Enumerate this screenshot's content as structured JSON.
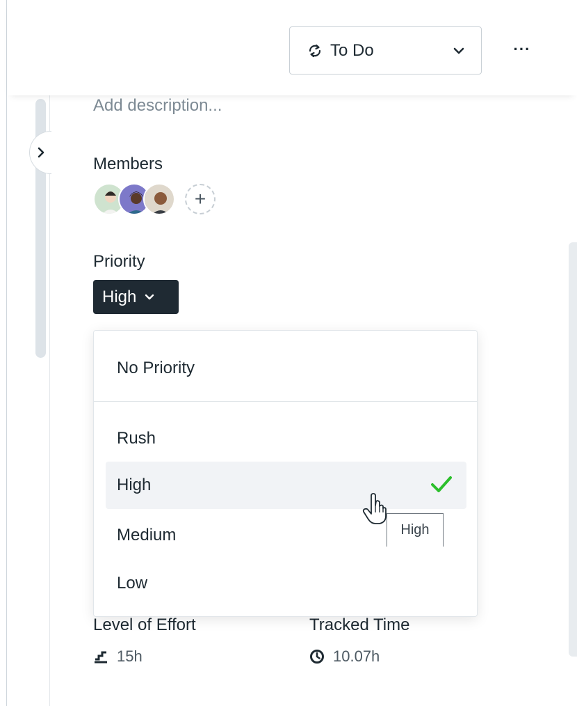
{
  "header": {
    "status": {
      "label": "To Do",
      "icon": "status-cycle-icon"
    },
    "more_label": "···"
  },
  "task": {
    "description_placeholder": "Add description...",
    "members": {
      "label": "Members",
      "avatars": [
        "member-avatar-1",
        "member-avatar-2",
        "member-avatar-3"
      ],
      "add_label": "+"
    },
    "priority": {
      "label": "Priority",
      "value": "High"
    },
    "level_of_effort": {
      "label": "Level of Effort",
      "value": "15h",
      "icon": "effort-stairs-icon"
    },
    "tracked_time": {
      "label": "Tracked Time",
      "value": "10.07h",
      "icon": "clock-icon"
    }
  },
  "priority_menu": {
    "options": [
      "No Priority",
      "Rush",
      "High",
      "Medium",
      "Low"
    ],
    "selected": "High",
    "check_color": "#2cbf2c"
  },
  "tooltip": {
    "text": "High"
  },
  "colors": {
    "priority_button_bg": "#1f2a33",
    "selected_row_bg": "#f1f3f6",
    "placeholder_text": "#7d8a94"
  }
}
